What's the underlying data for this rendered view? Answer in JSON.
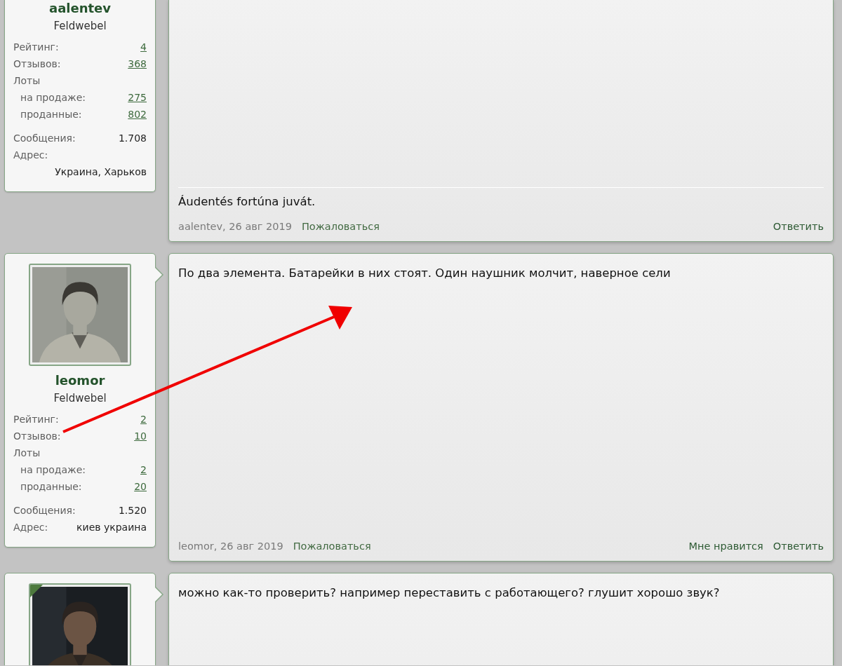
{
  "posts": [
    {
      "user": {
        "name": "aalentev",
        "rank": "Feldwebel"
      },
      "stats": [
        {
          "label": "Рейтинг:",
          "value": "4",
          "kind": "link"
        },
        {
          "label": "Отзывов:",
          "value": "368",
          "kind": "link"
        },
        {
          "label": "Лоты",
          "kind": "group",
          "children": [
            {
              "label": "на продаже:",
              "value": "275",
              "kind": "link"
            },
            {
              "label": "проданные:",
              "value": "802",
              "kind": "link"
            }
          ]
        },
        {
          "label": "Сообщения:",
          "value": "1.708",
          "kind": "text"
        },
        {
          "label": "Адрес:",
          "value": "Украина, Харьков",
          "kind": "wrap"
        }
      ],
      "message": {
        "signature": "Áudentés fortúna juvát."
      },
      "footer": {
        "author_date": "aalentev, 26 авг 2019",
        "report": "Пожаловаться",
        "actions": [
          "Ответить"
        ]
      }
    },
    {
      "user": {
        "name": "leomor",
        "rank": "Feldwebel",
        "avatar": {
          "kind": "picture",
          "online": false
        }
      },
      "stats": [
        {
          "label": "Рейтинг:",
          "value": "2",
          "kind": "link"
        },
        {
          "label": "Отзывов:",
          "value": "10",
          "kind": "link"
        },
        {
          "label": "Лоты",
          "kind": "group",
          "children": [
            {
              "label": "на продаже:",
              "value": "2",
              "kind": "link"
            },
            {
              "label": "проданные:",
              "value": "20",
              "kind": "link"
            }
          ]
        },
        {
          "label": "Сообщения:",
          "value": "1.520",
          "kind": "text"
        },
        {
          "label": "Адрес:",
          "value": "киев украина",
          "kind": "text"
        }
      ],
      "message": {
        "text": "По два элемента. Батарейки в них стоят. Один наушник молчит, наверное сели"
      },
      "footer": {
        "author_date": "leomor, 26 авг 2019",
        "report": "Пожаловаться",
        "actions": [
          "Мне нравится",
          "Ответить"
        ]
      }
    },
    {
      "user": {
        "avatar": {
          "kind": "picture",
          "online": true
        }
      },
      "message": {
        "text": "можно как-то проверить? например переставить с работающего? глушит хорошо звук?"
      }
    }
  ],
  "annotations": [
    {
      "kind": "arrow"
    }
  ]
}
